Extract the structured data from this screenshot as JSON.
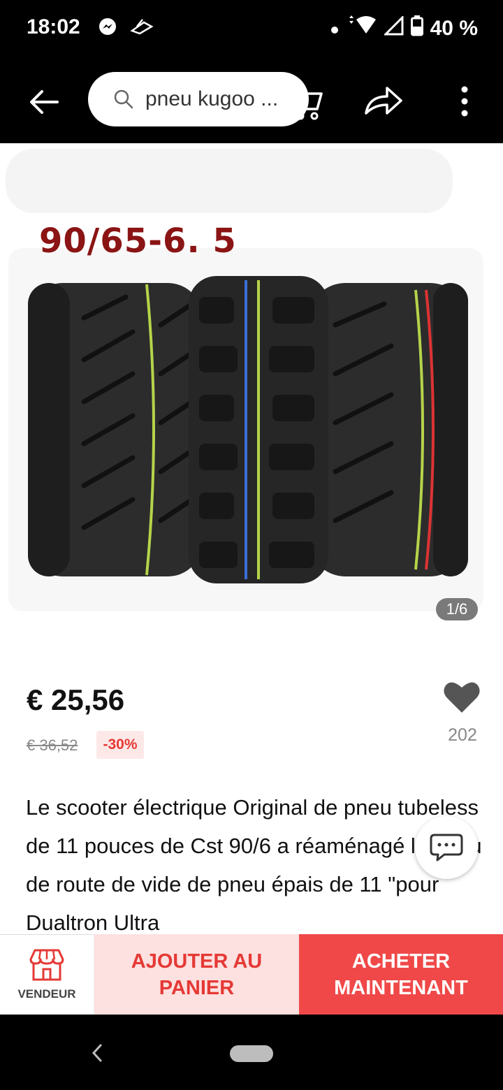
{
  "status_bar": {
    "time": "18:02",
    "battery": "40 %",
    "icons": [
      "messenger-icon",
      "app-icon",
      "dot-icon",
      "wifi-icon",
      "signal-icon",
      "battery-icon"
    ]
  },
  "header": {
    "search_text": "pneu kugoo ...",
    "icons": [
      "back-arrow-icon",
      "search-icon",
      "cart-icon",
      "share-icon",
      "more-vertical-icon"
    ]
  },
  "gallery": {
    "image_label": "90/65-6. 5",
    "page_counter": "1/6"
  },
  "product": {
    "price": "€ 25,56",
    "old_price": "€ 36,52",
    "discount": "-30%",
    "favorites_count": "202",
    "description": "Le scooter électrique Original de pneu tubeless de 11 pouces de Cst 90/6 a réaménagé le pneu de route de vide de pneu épais de 11 \"pour Dualtron Ultra"
  },
  "actions": {
    "vendor_label": "VENDEUR",
    "add_to_cart_label": "AJOUTER AU PANIER",
    "buy_now_label": "ACHETER MAINTENANT"
  },
  "colors": {
    "accent_red": "#f04848",
    "light_red": "#fde0e0",
    "discount_text": "#e53935",
    "label_red": "#8b1414"
  }
}
